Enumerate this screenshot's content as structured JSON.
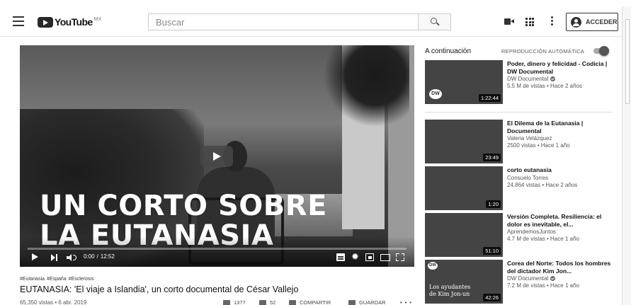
{
  "header": {
    "logo_text": "YouTube",
    "country_code": "MX",
    "search_placeholder": "Buscar",
    "signin_label": "ACCEDER"
  },
  "player": {
    "overlay_line1": "UN CORTO SOBRE",
    "overlay_line2": "LA EUTANASIA",
    "current_time": "0:00",
    "separator": "/",
    "duration": "12:52",
    "progress_fraction": 0
  },
  "video": {
    "tags": [
      "#Eutanasia",
      "#España",
      "#Esclerosis"
    ],
    "title": "EUTANASIA: 'El viaje a Islandia', un corto documental de César Vallejo",
    "views_date": "65,350 vistas • 6 abr. 2019",
    "likes": "1377",
    "dislikes": "52",
    "share_label": "COMPARTIR",
    "save_label": "GUARDAR"
  },
  "sidebar": {
    "up_next_label": "A continuación",
    "autoplay_label": "REPRODUCCIÓN AUTOMÁTICA",
    "autoplay_on": true,
    "items": [
      {
        "title": "Poder, dinero y felicidad - Codicia | DW Documental",
        "channel": "DW Documental",
        "verified": true,
        "meta": "5.5 M de vistas • Hace 2 años",
        "duration": "1:22:44"
      },
      {
        "title": "El Dilema de la Eutanasia | Documental",
        "channel": "Valeria Velázquez",
        "verified": false,
        "meta": "2500 vistas • Hace 1 año",
        "duration": "23:49"
      },
      {
        "title": "corto eutanasia",
        "channel": "Consuelo Torres",
        "verified": false,
        "meta": "24,864 vistas • Hace 2 años",
        "duration": "1:20"
      },
      {
        "title": "Versión Completa. Resiliencia: el dolor es inevitable, el...",
        "channel": "AprendemosJuntos",
        "verified": false,
        "meta": "4.7 M de vistas • Hace 1 año",
        "duration": "51:10"
      },
      {
        "title": "Corea del Norte: Todos los hombres del dictador Kim Jon...",
        "channel": "DW Documental",
        "verified": true,
        "meta": "7.2 M de vistas • Hace 1 año",
        "duration": "42:26",
        "thumb_caption_1": "Los ayudantes",
        "thumb_caption_2": "de Kim Jon-un"
      }
    ]
  },
  "icons": {
    "menu": "hamburger-menu-icon",
    "search": "search-icon",
    "upload": "video-camera-icon",
    "apps": "apps-grid-icon",
    "more": "more-vertical-icon",
    "account": "account-circle-icon"
  }
}
